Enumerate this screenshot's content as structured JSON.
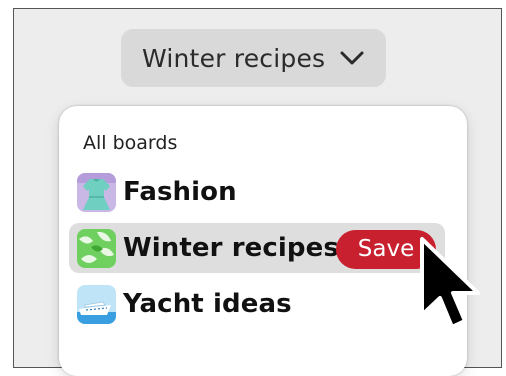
{
  "board_picker": {
    "selected_label": "Winter recipes",
    "chevron_icon": "chevron-down-icon"
  },
  "menu": {
    "section_label": "All boards",
    "boards": [
      {
        "name": "Fashion",
        "icon": "fashion-board-thumbnail"
      },
      {
        "name": "Winter recipes",
        "icon": "leaves-board-thumbnail",
        "selected": true
      },
      {
        "name": "Yacht ideas",
        "icon": "yacht-board-thumbnail"
      }
    ],
    "save_label": "Save"
  },
  "colors": {
    "save_button": "#c8202e",
    "selected_row": "#dedede",
    "picker_bg": "#d9d9d9"
  },
  "cursor_icon": "mouse-pointer-icon"
}
